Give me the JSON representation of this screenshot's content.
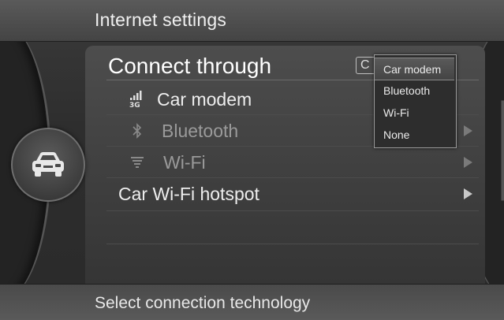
{
  "header": {
    "title": "Internet settings"
  },
  "footer": {
    "status_text": "Select connection technology"
  },
  "settings": {
    "connect_through": {
      "label": "Connect through",
      "value_short": "C"
    },
    "items": [
      {
        "label": "Car modem",
        "icon": "signal-3g-icon",
        "enabled": true
      },
      {
        "label": "Bluetooth",
        "icon": "bluetooth-icon",
        "enabled": false
      },
      {
        "label": "Wi-Fi",
        "icon": "wifi-icon",
        "enabled": false
      },
      {
        "label": "Car Wi-Fi hotspot",
        "icon": "",
        "enabled": true
      }
    ]
  },
  "dropdown": {
    "options": [
      "Car modem",
      "Bluetooth",
      "Wi-Fi",
      "None"
    ],
    "selected": "Car modem"
  },
  "side_button": {
    "icon": "car-icon"
  },
  "colors": {
    "background": "#2c2c2c",
    "text": "#e6e6e6",
    "dim_text": "#9a9a9a"
  }
}
